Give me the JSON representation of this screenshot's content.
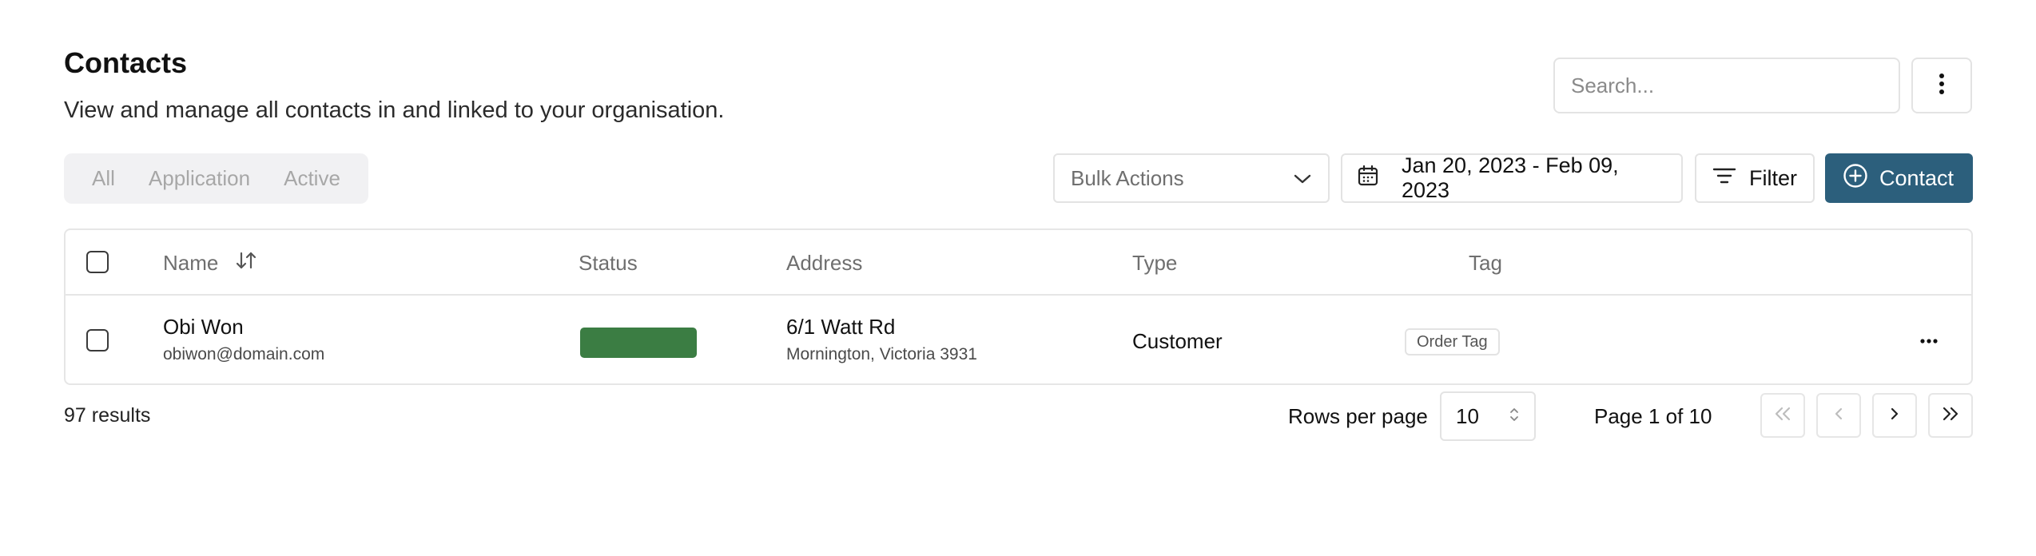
{
  "header": {
    "title": "Contacts",
    "subtitle": "View and manage all contacts in and linked to your organisation."
  },
  "search": {
    "placeholder": "Search..."
  },
  "icons": {
    "more": "kebab-vertical-icon",
    "calendar": "calendar-icon",
    "filter": "filter-lines-icon",
    "add": "plus-circle-icon",
    "sort": "sort-arrows-icon",
    "chevron": "chevron-down-icon",
    "row_menu": "ellipsis-horizontal-icon"
  },
  "tabs": [
    {
      "label": "All"
    },
    {
      "label": "Application"
    },
    {
      "label": "Active"
    }
  ],
  "toolbar": {
    "bulk_actions_label": "Bulk Actions",
    "date_range": "Jan 20, 2023 - Feb 09, 2023",
    "filter_label": "Filter",
    "contact_label": "Contact"
  },
  "table": {
    "columns": {
      "name": "Name",
      "status": "Status",
      "address": "Address",
      "type": "Type",
      "tag": "Tag"
    },
    "rows": [
      {
        "name": "Obi Won",
        "email": "obiwon@domain.com",
        "address_line1": "6/1 Watt Rd",
        "address_line2": "Mornington, Victoria 3931",
        "type": "Customer",
        "tag": "Order Tag"
      }
    ]
  },
  "footer": {
    "results": "97 results",
    "rows_per_page_label": "Rows per page",
    "rows_per_page_value": "10",
    "page_info": "Page 1 of 10"
  },
  "colors": {
    "primary": "#2c5f7c",
    "status_active": "#3b7d43",
    "border": "#e3e3e3"
  }
}
